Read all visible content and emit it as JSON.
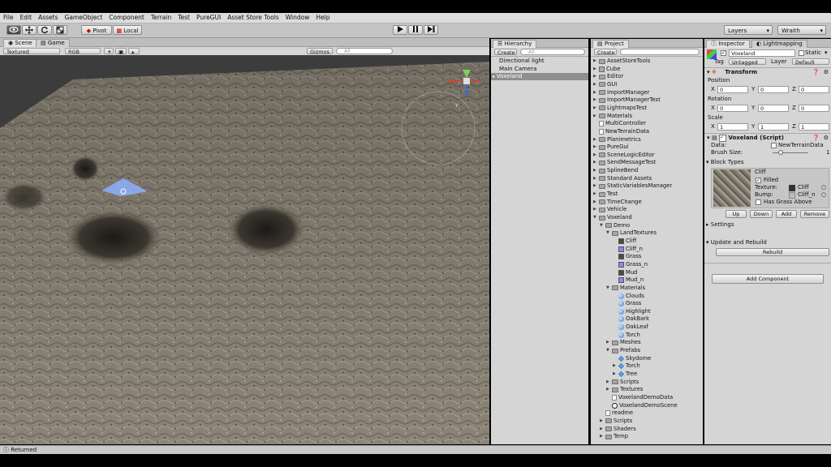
{
  "menu": [
    "File",
    "Edit",
    "Assets",
    "GameObject",
    "Component",
    "Terrain",
    "Test",
    "PureGUI",
    "Asset Store Tools",
    "Window",
    "Help"
  ],
  "toolbar": {
    "pivot_label": "Pivot",
    "local_label": "Local",
    "layers_label": "Layers",
    "layout_label": "Wraith"
  },
  "scene": {
    "tab_scene": "Scene",
    "tab_game": "Game",
    "shading_mode": "Textured",
    "render_mode": "RGB",
    "gizmos_label": "Gizmos",
    "search_placeholder": "All"
  },
  "hierarchy": {
    "tab_label": "Hierarchy",
    "create_label": "Create",
    "search_placeholder": "All",
    "items": [
      "Directional light",
      "Main Camera",
      "Voxeland"
    ],
    "selected_index": 2
  },
  "project": {
    "tab_label": "Project",
    "create_label": "Create",
    "search_placeholder": "",
    "items": [
      {
        "label": "AssetStoreTools",
        "icon": "folder",
        "indent": 0,
        "arrow": "closed"
      },
      {
        "label": "Cube",
        "icon": "cube",
        "indent": 0,
        "arrow": "closed"
      },
      {
        "label": "Editor",
        "icon": "folder",
        "indent": 0,
        "arrow": "closed"
      },
      {
        "label": "GUI",
        "icon": "folder",
        "indent": 0,
        "arrow": "closed"
      },
      {
        "label": "ImportManager",
        "icon": "folder",
        "indent": 0,
        "arrow": "closed"
      },
      {
        "label": "ImportManagerTest",
        "icon": "folder",
        "indent": 0,
        "arrow": "closed"
      },
      {
        "label": "LightmapsTest",
        "icon": "folder",
        "indent": 0,
        "arrow": "closed"
      },
      {
        "label": "Materials",
        "icon": "folder",
        "indent": 0,
        "arrow": "closed"
      },
      {
        "label": "MultiController",
        "icon": "file",
        "indent": 0,
        "arrow": "none"
      },
      {
        "label": "NewTerrainData",
        "icon": "file",
        "indent": 0,
        "arrow": "none"
      },
      {
        "label": "Planimetrics",
        "icon": "folder",
        "indent": 0,
        "arrow": "closed"
      },
      {
        "label": "PureGui",
        "icon": "folder",
        "indent": 0,
        "arrow": "closed"
      },
      {
        "label": "SceneLogicEditor",
        "icon": "folder",
        "indent": 0,
        "arrow": "closed"
      },
      {
        "label": "SendMessageTest",
        "icon": "folder",
        "indent": 0,
        "arrow": "closed"
      },
      {
        "label": "SplineBend",
        "icon": "folder",
        "indent": 0,
        "arrow": "closed"
      },
      {
        "label": "Standard Assets",
        "icon": "folder",
        "indent": 0,
        "arrow": "closed"
      },
      {
        "label": "StaticVariablesManager",
        "icon": "folder",
        "indent": 0,
        "arrow": "closed"
      },
      {
        "label": "Test",
        "icon": "folder",
        "indent": 0,
        "arrow": "closed"
      },
      {
        "label": "TimeChange",
        "icon": "folder",
        "indent": 0,
        "arrow": "closed"
      },
      {
        "label": "Vehicle",
        "icon": "folder",
        "indent": 0,
        "arrow": "closed"
      },
      {
        "label": "Voxeland",
        "icon": "folder",
        "indent": 0,
        "arrow": "open"
      },
      {
        "label": "Demo",
        "icon": "folder",
        "indent": 1,
        "arrow": "open"
      },
      {
        "label": "LandTextures",
        "icon": "folder",
        "indent": 2,
        "arrow": "open"
      },
      {
        "label": "Cliff",
        "icon": "tex-dark",
        "indent": 3,
        "arrow": "none"
      },
      {
        "label": "Cliff_n",
        "icon": "tex-blue",
        "indent": 3,
        "arrow": "none"
      },
      {
        "label": "Grass",
        "icon": "tex-dark",
        "indent": 3,
        "arrow": "none"
      },
      {
        "label": "Grass_n",
        "icon": "tex-blue",
        "indent": 3,
        "arrow": "none"
      },
      {
        "label": "Mud",
        "icon": "tex-dark",
        "indent": 3,
        "arrow": "none"
      },
      {
        "label": "Mud_n",
        "icon": "tex-blue",
        "indent": 3,
        "arrow": "none"
      },
      {
        "label": "Materials",
        "icon": "folder",
        "indent": 2,
        "arrow": "open"
      },
      {
        "label": "Clouds",
        "icon": "material",
        "indent": 3,
        "arrow": "none"
      },
      {
        "label": "Grass",
        "icon": "material",
        "indent": 3,
        "arrow": "none"
      },
      {
        "label": "Highlight",
        "icon": "material",
        "indent": 3,
        "arrow": "none"
      },
      {
        "label": "OakBark",
        "icon": "material",
        "indent": 3,
        "arrow": "none"
      },
      {
        "label": "OakLeaf",
        "icon": "material",
        "indent": 3,
        "arrow": "none"
      },
      {
        "label": "Torch",
        "icon": "material",
        "indent": 3,
        "arrow": "none"
      },
      {
        "label": "Meshes",
        "icon": "folder",
        "indent": 2,
        "arrow": "closed"
      },
      {
        "label": "Prefabs",
        "icon": "folder",
        "indent": 2,
        "arrow": "open"
      },
      {
        "label": "Skydome",
        "icon": "prefab",
        "indent": 3,
        "arrow": "none"
      },
      {
        "label": "Torch",
        "icon": "prefab",
        "indent": 3,
        "arrow": "closed"
      },
      {
        "label": "Tree",
        "icon": "prefab",
        "indent": 3,
        "arrow": "closed"
      },
      {
        "label": "Scripts",
        "icon": "folder",
        "indent": 2,
        "arrow": "closed"
      },
      {
        "label": "Textures",
        "icon": "folder",
        "indent": 2,
        "arrow": "closed"
      },
      {
        "label": "VoxelandDemoData",
        "icon": "file",
        "indent": 2,
        "arrow": "none"
      },
      {
        "label": "VoxelandDemoScene",
        "icon": "scene",
        "indent": 2,
        "arrow": "none"
      },
      {
        "label": "readme",
        "icon": "file",
        "indent": 1,
        "arrow": "none"
      },
      {
        "label": "Scripts",
        "icon": "folder",
        "indent": 1,
        "arrow": "closed"
      },
      {
        "label": "Shaders",
        "icon": "folder",
        "indent": 1,
        "arrow": "closed"
      },
      {
        "label": "Temp",
        "icon": "folder",
        "indent": 1,
        "arrow": "closed"
      }
    ]
  },
  "inspector": {
    "tab_inspector": "Inspector",
    "tab_lightmapping": "Lightmapping",
    "object_name": "Voxeland",
    "static_label": "Static",
    "tag_label": "Tag",
    "tag_value": "Untagged",
    "layer_label": "Layer",
    "layer_value": "Default",
    "transform": {
      "title": "Transform",
      "position_label": "Position",
      "rotation_label": "Rotation",
      "scale_label": "Scale",
      "position": {
        "x": "0",
        "y": "0",
        "z": "0"
      },
      "rotation": {
        "x": "0",
        "y": "0",
        "z": "0"
      },
      "scale": {
        "x": "1",
        "y": "1",
        "z": "1"
      }
    },
    "script": {
      "title": "Voxeland (Script)",
      "data_label": "Data:",
      "data_value": "NewTerrainData",
      "brush_label": "Brush Size:",
      "brush_value": "1",
      "block_types_label": "Block Types",
      "block_name": "Cliff",
      "filled_label": "Filled",
      "texture_label": "Texture:",
      "texture_value": "Cliff",
      "bump_label": "Bump:",
      "bump_value": "Cliff_n",
      "grass_label": "Has Grass Above",
      "btn_up": "Up",
      "btn_down": "Down",
      "btn_add": "Add",
      "btn_remove": "Remove",
      "settings_label": "Settings",
      "update_label": "Update and Rebuild",
      "rebuild_label": "Rebuild"
    },
    "add_component_label": "Add Component"
  },
  "status": {
    "message": "Returned"
  },
  "axes": {
    "x": "x",
    "y": "y",
    "z": "z",
    "X": "X",
    "Y": "Y",
    "Z": "Z"
  }
}
